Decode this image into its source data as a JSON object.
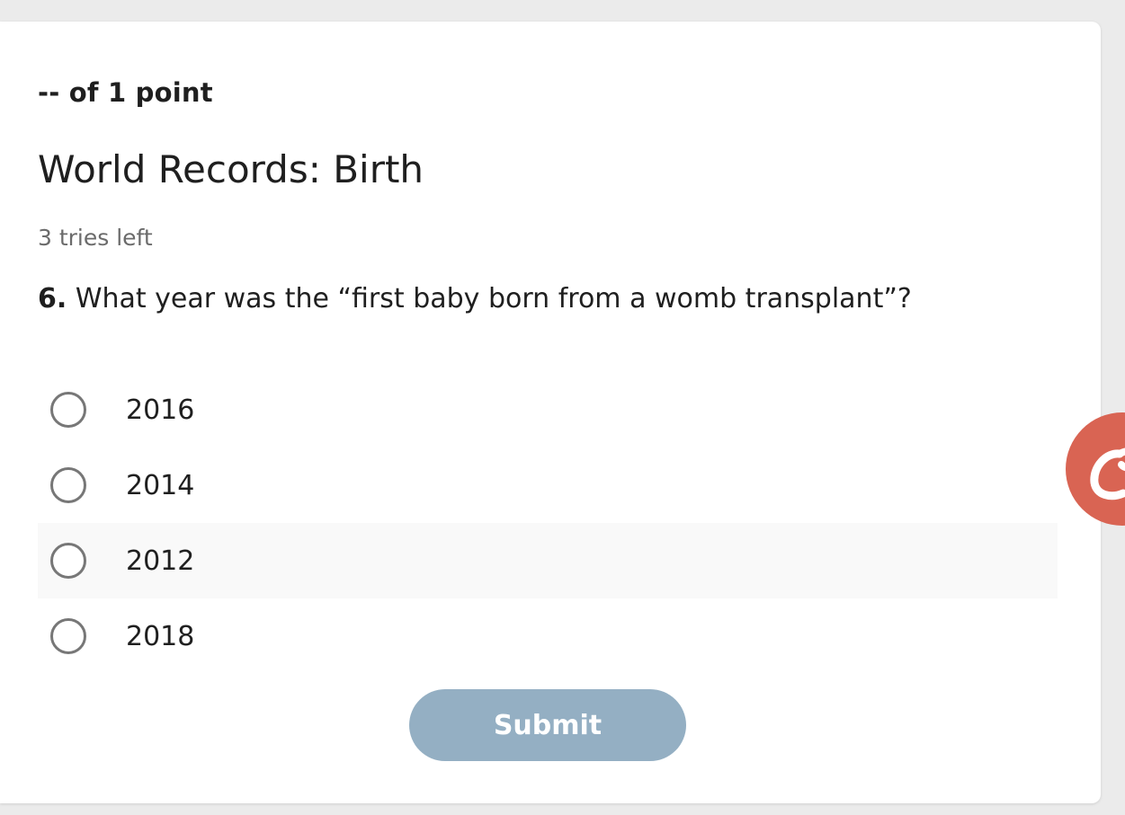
{
  "quiz": {
    "points": "-- of 1 point",
    "title": "World Records: Birth",
    "tries": "3 tries left",
    "question_number": "6.",
    "question_text": " What year was the “first baby born from a womb transplant”?",
    "options": [
      {
        "label": "2016"
      },
      {
        "label": "2014"
      },
      {
        "label": "2012"
      },
      {
        "label": "2018"
      }
    ],
    "submit_label": "Submit"
  },
  "colors": {
    "submit_bg": "#94afc3",
    "help_bubble": "#d96453",
    "hover_row": "#f9f9f9"
  },
  "icons": {
    "help_bubble": "chat-swirl-icon"
  }
}
